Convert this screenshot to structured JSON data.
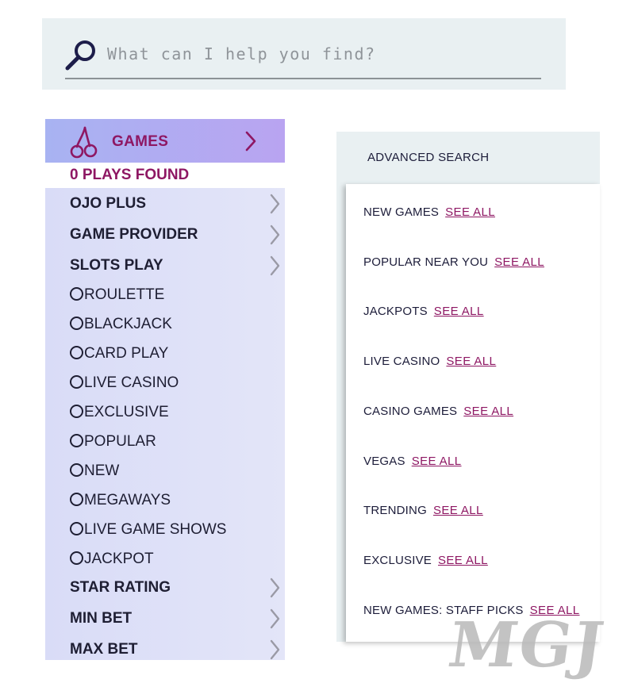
{
  "search": {
    "placeholder": "What can I help you find?",
    "icon": "magnifier-icon"
  },
  "filters": {
    "header": {
      "label": "GAMES",
      "icon": "cherry-icon"
    },
    "plays_found": "0 PLAYS FOUND",
    "items": [
      {
        "label": "OJO PLUS",
        "type": "section"
      },
      {
        "label": "GAME PROVIDER",
        "type": "section"
      },
      {
        "label": "SLOTS PLAY",
        "type": "section"
      },
      {
        "label": "ROULETTE",
        "type": "option"
      },
      {
        "label": "BLACKJACK",
        "type": "option"
      },
      {
        "label": "CARD PLAY",
        "type": "option"
      },
      {
        "label": "LIVE CASINO",
        "type": "option"
      },
      {
        "label": "EXCLUSIVE",
        "type": "option"
      },
      {
        "label": "POPULAR",
        "type": "option"
      },
      {
        "label": "NEW",
        "type": "option"
      },
      {
        "label": "MEGAWAYS",
        "type": "option"
      },
      {
        "label": "LIVE GAME SHOWS",
        "type": "option"
      },
      {
        "label": "JACKPOT",
        "type": "option"
      },
      {
        "label": "STAR RATING",
        "type": "section"
      },
      {
        "label": "MIN BET",
        "type": "section"
      },
      {
        "label": "MAX BET",
        "type": "section"
      }
    ]
  },
  "advanced": {
    "title": "ADVANCED SEARCH",
    "see_all": "SEE ALL",
    "categories": [
      "NEW GAMES",
      "POPULAR NEAR YOU",
      "JACKPOTS",
      "LIVE CASINO",
      "CASINO GAMES",
      "VEGAS",
      "TRENDING",
      "EXCLUSIVE",
      "NEW GAMES: STAFF PICKS"
    ]
  },
  "watermark": "MGJ",
  "colors": {
    "accent": "#8e1763",
    "panel": "#dfe1f7",
    "search_bg": "#e9f0f2"
  }
}
